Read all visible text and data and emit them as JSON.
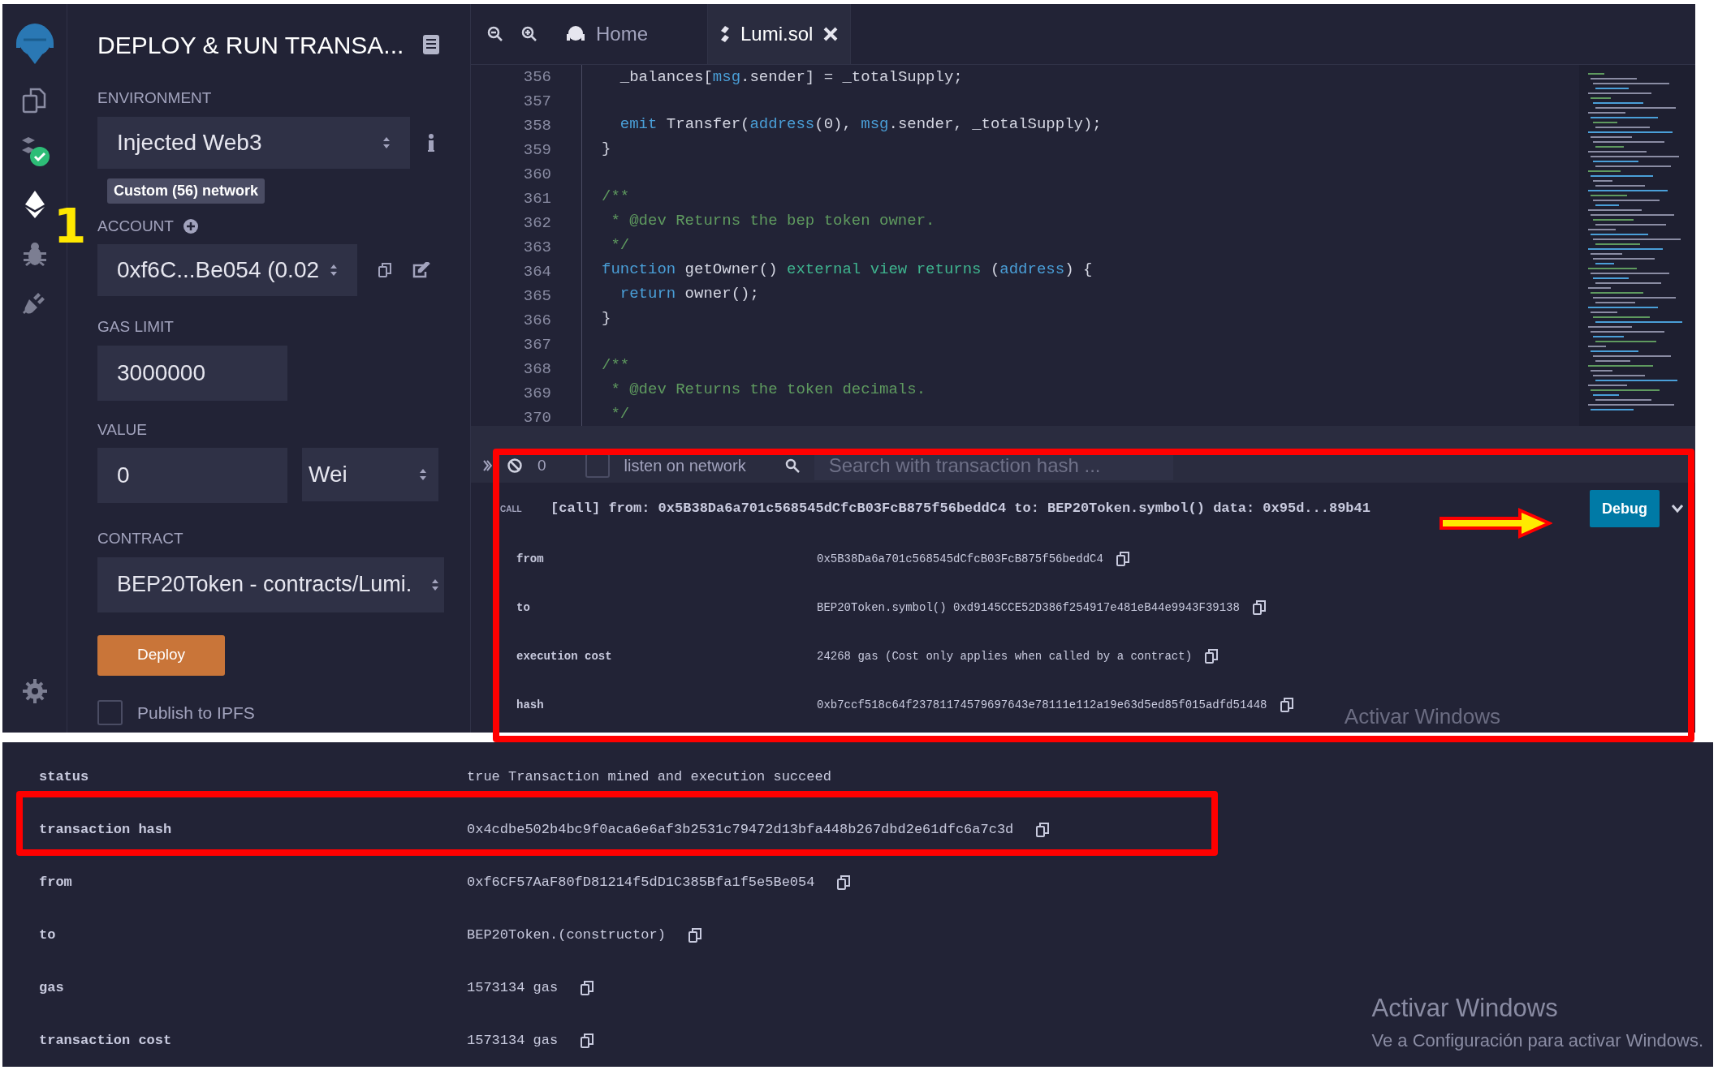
{
  "step_marker": "1",
  "panel": {
    "title": "DEPLOY & RUN TRANSA...",
    "environment": {
      "label": "ENVIRONMENT",
      "value": "Injected Web3",
      "badge": "Custom (56) network"
    },
    "account": {
      "label": "ACCOUNT",
      "value": "0xf6C...Be054 (0.02"
    },
    "gas_limit": {
      "label": "GAS LIMIT",
      "value": "3000000"
    },
    "value": {
      "label": "VALUE",
      "value": "0",
      "unit": "Wei"
    },
    "contract": {
      "label": "CONTRACT",
      "value": "BEP20Token - contracts/Lumi."
    },
    "deploy_button": "Deploy",
    "publish": {
      "label": "Publish to IPFS",
      "checked": false
    }
  },
  "tabs": [
    {
      "label": "Home",
      "selected": false,
      "closable": false
    },
    {
      "label": "Lumi.sol",
      "selected": true,
      "closable": true
    }
  ],
  "editor": {
    "lines": [
      {
        "number": "356",
        "tokens": [
          {
            "text": "  _balances[",
            "kind": "plain"
          },
          {
            "text": "msg",
            "kind": "keyword"
          },
          {
            "text": ".sender] = _totalSupply;",
            "kind": "plain"
          }
        ]
      },
      {
        "number": "357"
      },
      {
        "number": "358",
        "tokens": [
          {
            "text": "  emit",
            "kind": "keyword"
          },
          {
            "text": " Transfer(",
            "kind": "plain"
          },
          {
            "text": "address",
            "kind": "keyword"
          },
          {
            "text": "(0), ",
            "kind": "plain"
          },
          {
            "text": "msg",
            "kind": "keyword"
          },
          {
            "text": ".sender, _totalSupply);",
            "kind": "plain"
          }
        ]
      },
      {
        "number": "359",
        "tokens": [
          {
            "text": "}",
            "kind": "plain"
          }
        ]
      },
      {
        "number": "360"
      },
      {
        "number": "361",
        "tokens": [
          {
            "text": "/**",
            "kind": "comment"
          }
        ]
      },
      {
        "number": "362",
        "tokens": [
          {
            "text": " * @dev Returns the bep token owner.",
            "kind": "comment"
          }
        ]
      },
      {
        "number": "363",
        "tokens": [
          {
            "text": " */",
            "kind": "comment"
          }
        ]
      },
      {
        "number": "364",
        "tokens": [
          {
            "text": "function",
            "kind": "keyword"
          },
          {
            "text": " getOwner() ",
            "kind": "plain"
          },
          {
            "text": "external view returns",
            "kind": "modifier"
          },
          {
            "text": " (",
            "kind": "plain"
          },
          {
            "text": "address",
            "kind": "keyword"
          },
          {
            "text": ") {",
            "kind": "plain"
          }
        ]
      },
      {
        "number": "365",
        "tokens": [
          {
            "text": "  return",
            "kind": "keyword"
          },
          {
            "text": " owner();",
            "kind": "plain"
          }
        ]
      },
      {
        "number": "366",
        "tokens": [
          {
            "text": "}",
            "kind": "plain"
          }
        ]
      },
      {
        "number": "367"
      },
      {
        "number": "368",
        "tokens": [
          {
            "text": "/**",
            "kind": "comment"
          }
        ]
      },
      {
        "number": "369",
        "tokens": [
          {
            "text": " * @dev Returns the token decimals.",
            "kind": "comment"
          }
        ]
      },
      {
        "number": "370",
        "tokens": [
          {
            "text": " */",
            "kind": "comment"
          }
        ]
      }
    ]
  },
  "terminal": {
    "count": "0",
    "listen": {
      "label": "listen on network",
      "checked": false
    },
    "search": {
      "placeholder": "Search with transaction hash ..."
    },
    "call": {
      "tag": "CALL",
      "summary": "[call] from: 0x5B38Da6a701c568545dCfcB03FcB875f56beddC4 to: BEP20Token.symbol() data: 0x95d...89b41",
      "debug_button": "Debug"
    },
    "details": [
      {
        "key": "from",
        "value": "0x5B38Da6a701c568545dCfcB03FcB875f56beddC4",
        "copyable": true
      },
      {
        "key": "to",
        "value": "BEP20Token.symbol() 0xd9145CCE52D386f254917e481eB44e9943F39138",
        "copyable": true
      },
      {
        "key": "execution cost",
        "value": "24268 gas (Cost only applies when called by a contract)",
        "copyable": true
      },
      {
        "key": "hash",
        "value": "0xb7ccf518c64f23781174579697643e78111e112a19e63d5ed85f015adfd51448",
        "copyable": true
      }
    ],
    "notice": "Activar Windows"
  },
  "receipt": {
    "rows": [
      {
        "key": "status",
        "value": "true Transaction mined and execution succeed",
        "copyable": false
      },
      {
        "key": "transaction hash",
        "value": "0x4cdbe502b4bc9f0aca6e6af3b2531c79472d13bfa448b267dbd2e61dfc6a7c3d",
        "copyable": true
      },
      {
        "key": "from",
        "value": "0xf6CF57AaF80fD81214f5dD1C385Bfa1f5e5Be054",
        "copyable": true
      },
      {
        "key": "to",
        "value": "BEP20Token.(constructor)",
        "copyable": true
      },
      {
        "key": "gas",
        "value": "1573134 gas",
        "copyable": true
      },
      {
        "key": "transaction cost",
        "value": "1573134 gas",
        "copyable": true
      }
    ]
  },
  "windows_notice": {
    "title": "Activar Windows",
    "subtitle": "Ve a Configuración para activar Windows."
  }
}
